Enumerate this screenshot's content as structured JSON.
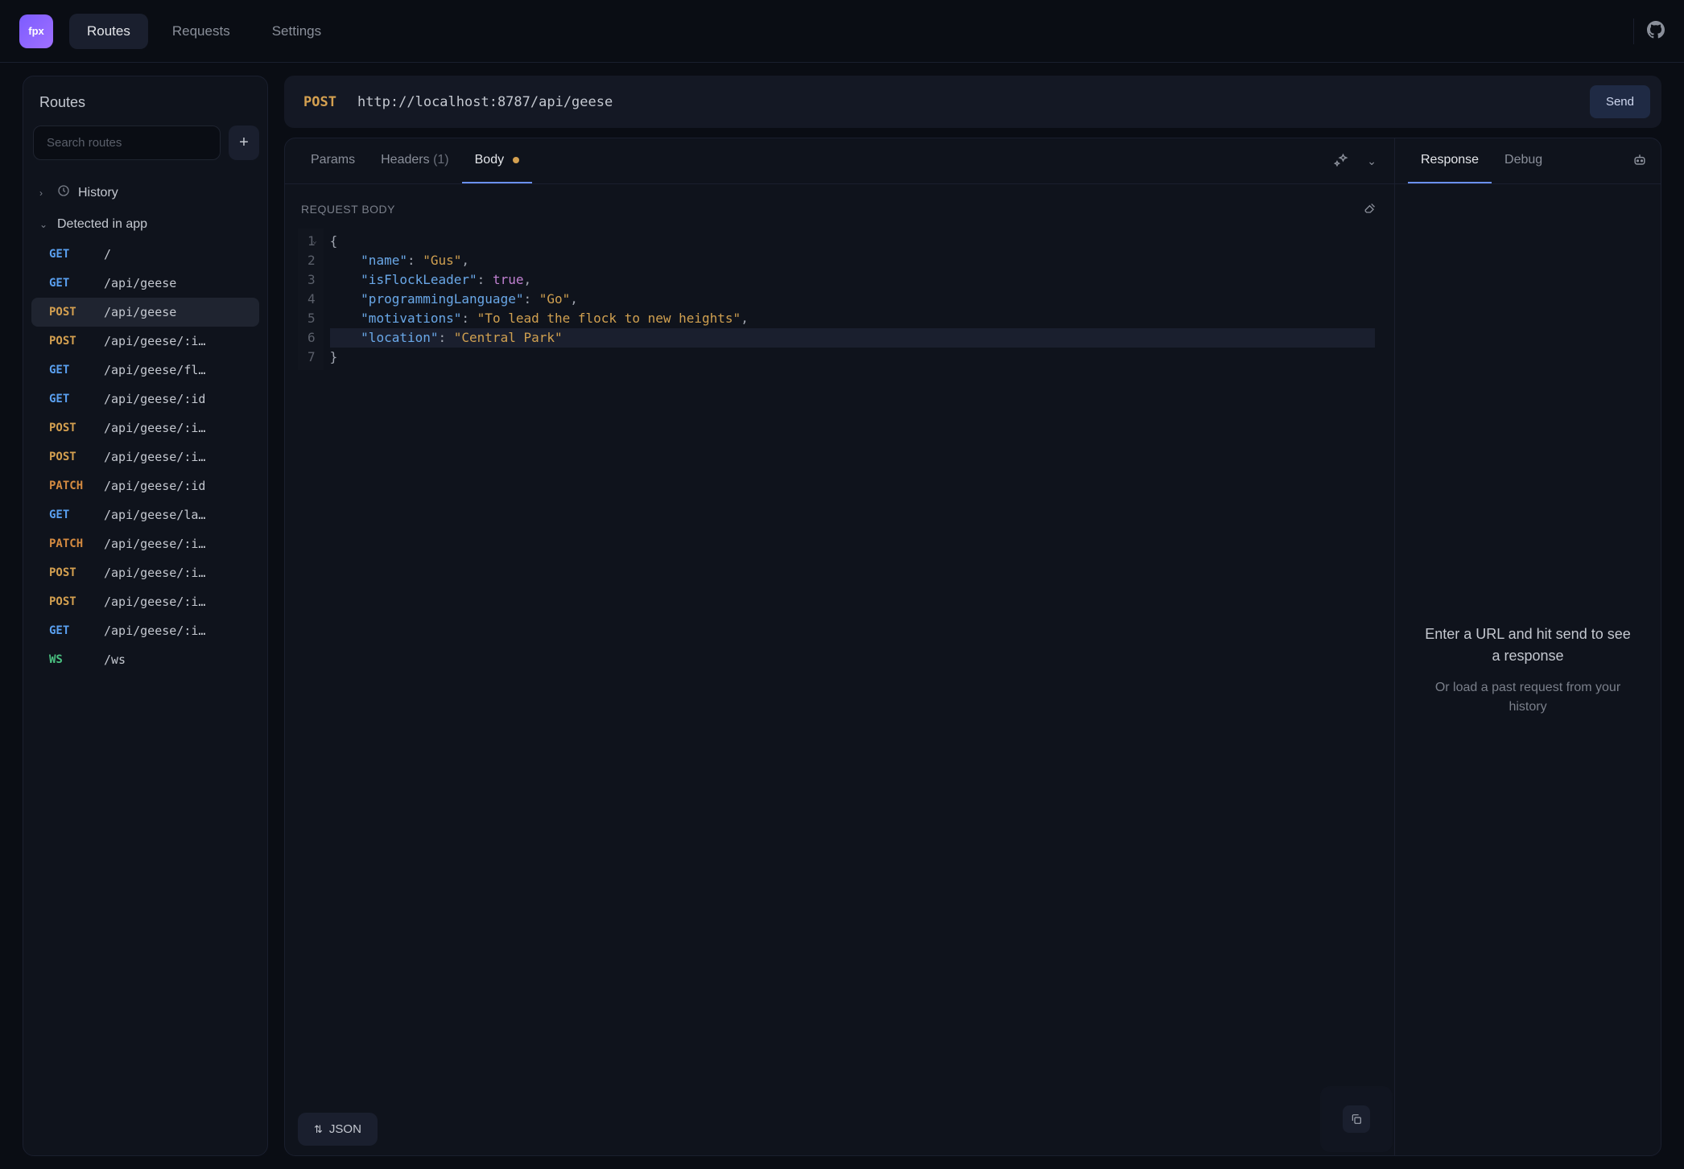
{
  "nav": {
    "logo": "fpx",
    "items": [
      "Routes",
      "Requests",
      "Settings"
    ],
    "active_index": 0
  },
  "sidebar": {
    "title": "Routes",
    "search_placeholder": "Search routes",
    "history_label": "History",
    "detected_label": "Detected in app",
    "routes": [
      {
        "method": "GET",
        "path": "/"
      },
      {
        "method": "GET",
        "path": "/api/geese"
      },
      {
        "method": "POST",
        "path": "/api/geese",
        "active": true
      },
      {
        "method": "POST",
        "path": "/api/geese/:i…"
      },
      {
        "method": "GET",
        "path": "/api/geese/fl…"
      },
      {
        "method": "GET",
        "path": "/api/geese/:id"
      },
      {
        "method": "POST",
        "path": "/api/geese/:i…"
      },
      {
        "method": "POST",
        "path": "/api/geese/:i…"
      },
      {
        "method": "PATCH",
        "path": "/api/geese/:id"
      },
      {
        "method": "GET",
        "path": "/api/geese/la…"
      },
      {
        "method": "PATCH",
        "path": "/api/geese/:i…"
      },
      {
        "method": "POST",
        "path": "/api/geese/:i…"
      },
      {
        "method": "POST",
        "path": "/api/geese/:i…"
      },
      {
        "method": "GET",
        "path": "/api/geese/:i…"
      },
      {
        "method": "WS",
        "path": "/ws"
      }
    ]
  },
  "request": {
    "method": "POST",
    "url": "http://localhost:8787/api/geese",
    "send_label": "Send",
    "tabs": {
      "params": "Params",
      "headers": "Headers",
      "headers_count": "(1)",
      "body": "Body"
    },
    "body_label": "REQUEST BODY",
    "format_label": "JSON",
    "body_json": {
      "name": "Gus",
      "isFlockLeader": true,
      "programmingLanguage": "Go",
      "motivations": "To lead the flock to new heights",
      "location": "Central Park"
    },
    "highlighted_line": 6
  },
  "response": {
    "tabs": {
      "response": "Response",
      "debug": "Debug"
    },
    "empty_main": "Enter a URL and hit send to see a response",
    "empty_sub": "Or load a past request from your history"
  }
}
